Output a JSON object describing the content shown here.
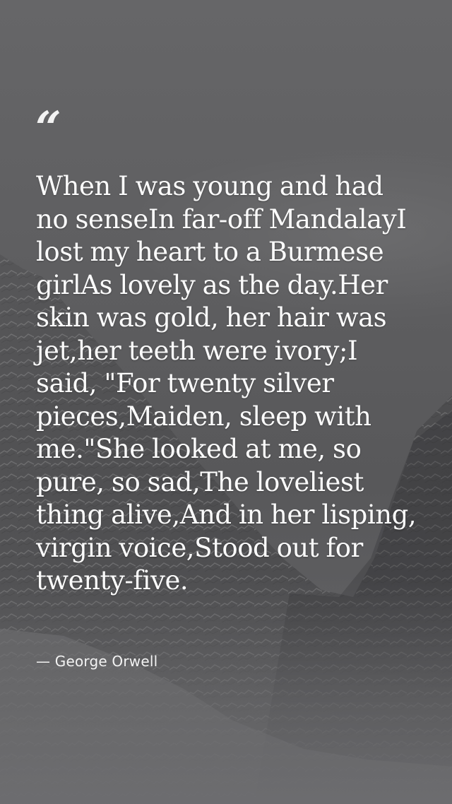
{
  "quote": {
    "mark": "“",
    "text": "When I was young and had no senseIn far-off MandalayI lost my heart to a Burmese girlAs lovely as the day.Her skin was gold, her hair was jet,her teeth were ivory;I said, \"For twenty silver pieces,Maiden, sleep with me.\"She looked at me, so pure, so sad,The loveliest thing alive,And in her lisping, virgin voice,Stood out for twenty-five.",
    "author": "— George Orwell"
  },
  "colors": {
    "background": "#5f5f61",
    "text": "#fbfbfb"
  }
}
